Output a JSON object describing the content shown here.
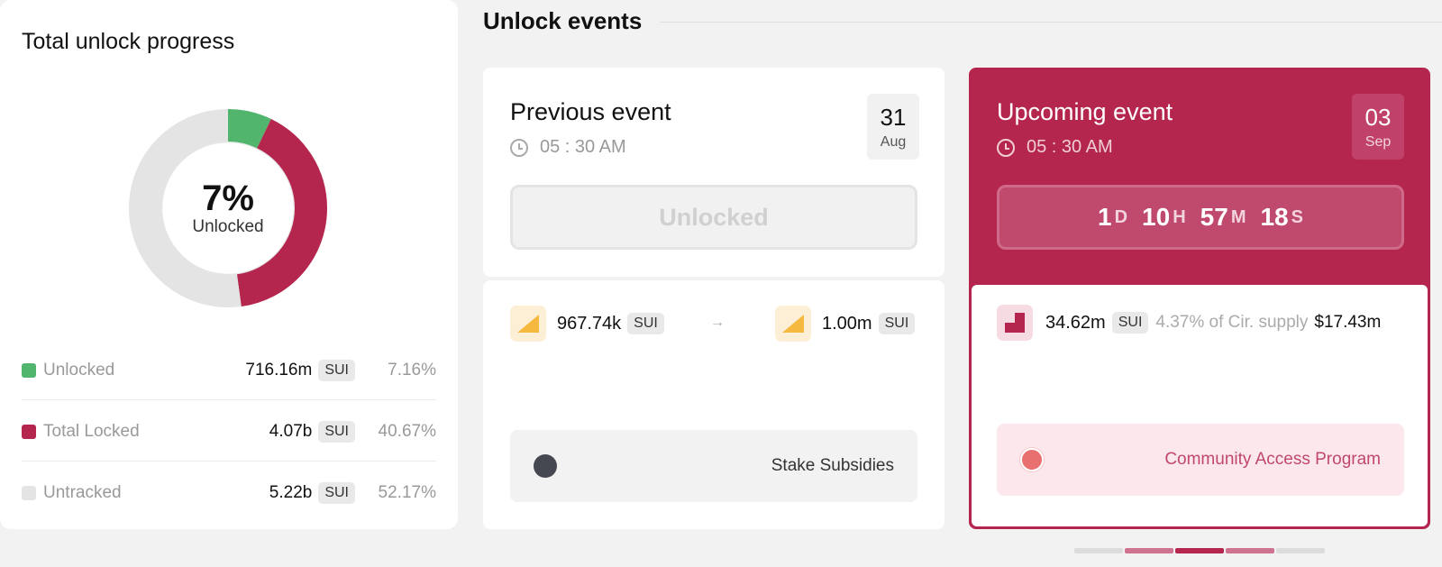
{
  "progress": {
    "title": "Total unlock progress",
    "percent": "7%",
    "percent_sub": "Unlocked",
    "segments": [
      {
        "name": "Unlocked",
        "fraction": 0.0716,
        "color": "#52b56e"
      },
      {
        "name": "Total Locked",
        "fraction": 0.4067,
        "color": "#b4264d"
      },
      {
        "name": "Untracked",
        "fraction": 0.5217,
        "color": "#e4e4e4"
      }
    ],
    "legend": [
      {
        "label": "Unlocked",
        "amount": "716.16m",
        "token": "SUI",
        "pct": "7.16%",
        "color": "#52b56e"
      },
      {
        "label": "Total Locked",
        "amount": "4.07b",
        "token": "SUI",
        "pct": "40.67%",
        "color": "#b4264d"
      },
      {
        "label": "Untracked",
        "amount": "5.22b",
        "token": "SUI",
        "pct": "52.17%",
        "color": "#e4e4e4"
      }
    ]
  },
  "events": {
    "heading": "Unlock events",
    "previous": {
      "title": "Previous event",
      "time": "05 : 30 AM",
      "day": "31",
      "month": "Aug",
      "status": "Unlocked",
      "from_amount": "967.74k",
      "from_token": "SUI",
      "arrow": "→",
      "to_amount": "1.00m",
      "to_token": "SUI",
      "allocation": "Stake Subsidies",
      "allocation_color": "#454850"
    },
    "upcoming": {
      "title": "Upcoming event",
      "time": "05 : 30 AM",
      "day": "03",
      "month": "Sep",
      "countdown": {
        "d": "1",
        "d_unit": "D",
        "h": "10",
        "h_unit": "H",
        "m": "57",
        "m_unit": "M",
        "s": "18",
        "s_unit": "S"
      },
      "amount": "34.62m",
      "token": "SUI",
      "supply_note": "4.37% of Cir. supply",
      "usd": "$17.43m",
      "allocation": "Community Access Program",
      "allocation_color": "#e8716f"
    }
  },
  "pager": {
    "count": 5,
    "active_index": 2
  }
}
